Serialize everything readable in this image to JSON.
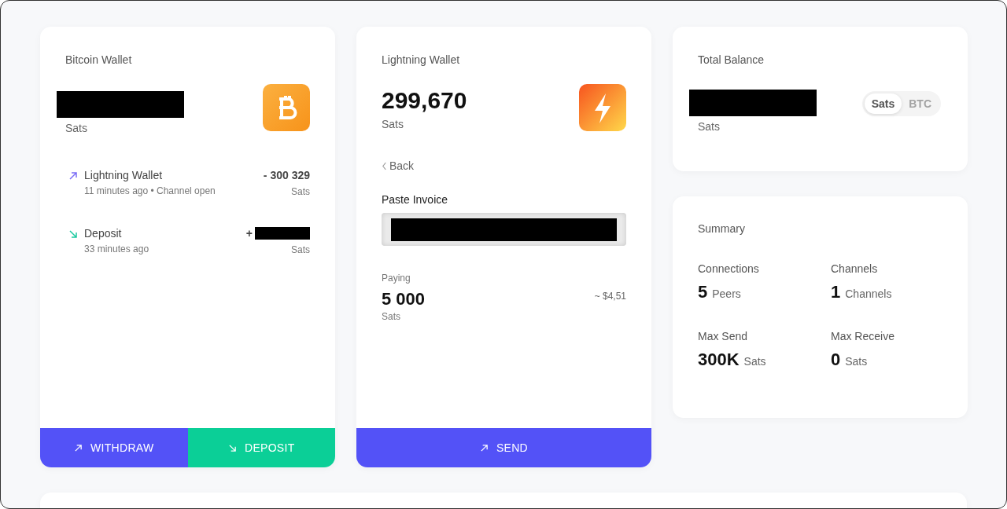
{
  "bitcoin_wallet": {
    "title": "Bitcoin Wallet",
    "balance_redacted": true,
    "unit": "Sats",
    "transactions": [
      {
        "kind": "out",
        "title": "Lightning Wallet",
        "subtitle": "11 minutes ago • Channel open",
        "amount": "- 300 329",
        "amount_redacted": false,
        "unit": "Sats"
      },
      {
        "kind": "in",
        "title": "Deposit",
        "subtitle": "33 minutes ago",
        "amount": "+",
        "amount_redacted": true,
        "unit": "Sats"
      }
    ],
    "buttons": [
      {
        "kind": "withdraw",
        "label": "WITHDRAW"
      },
      {
        "kind": "deposit",
        "label": "DEPOSIT"
      }
    ]
  },
  "lightning_wallet": {
    "title": "Lightning Wallet",
    "balance": "299,670",
    "unit": "Sats",
    "back": "Back",
    "invoice_label": "Paste Invoice",
    "invoice_redacted": true,
    "paying_label": "Paying",
    "paying_amount": "5 000",
    "paying_unit": "Sats",
    "fiat": "~ $4,51",
    "button": "SEND"
  },
  "total_balance": {
    "title": "Total Balance",
    "balance_redacted": true,
    "unit": "Sats",
    "toggle": [
      {
        "label": "Sats",
        "selected": true
      },
      {
        "label": "BTC",
        "selected": false
      }
    ]
  },
  "summary": {
    "title": "Summary",
    "stats": [
      {
        "label": "Connections",
        "value": "5",
        "unit": "Peers"
      },
      {
        "label": "Channels",
        "value": "1",
        "unit": "Channels"
      },
      {
        "label": "Max Send",
        "value": "300K",
        "unit": "Sats"
      },
      {
        "label": "Max Receive",
        "value": "0",
        "unit": "Sats"
      }
    ]
  }
}
